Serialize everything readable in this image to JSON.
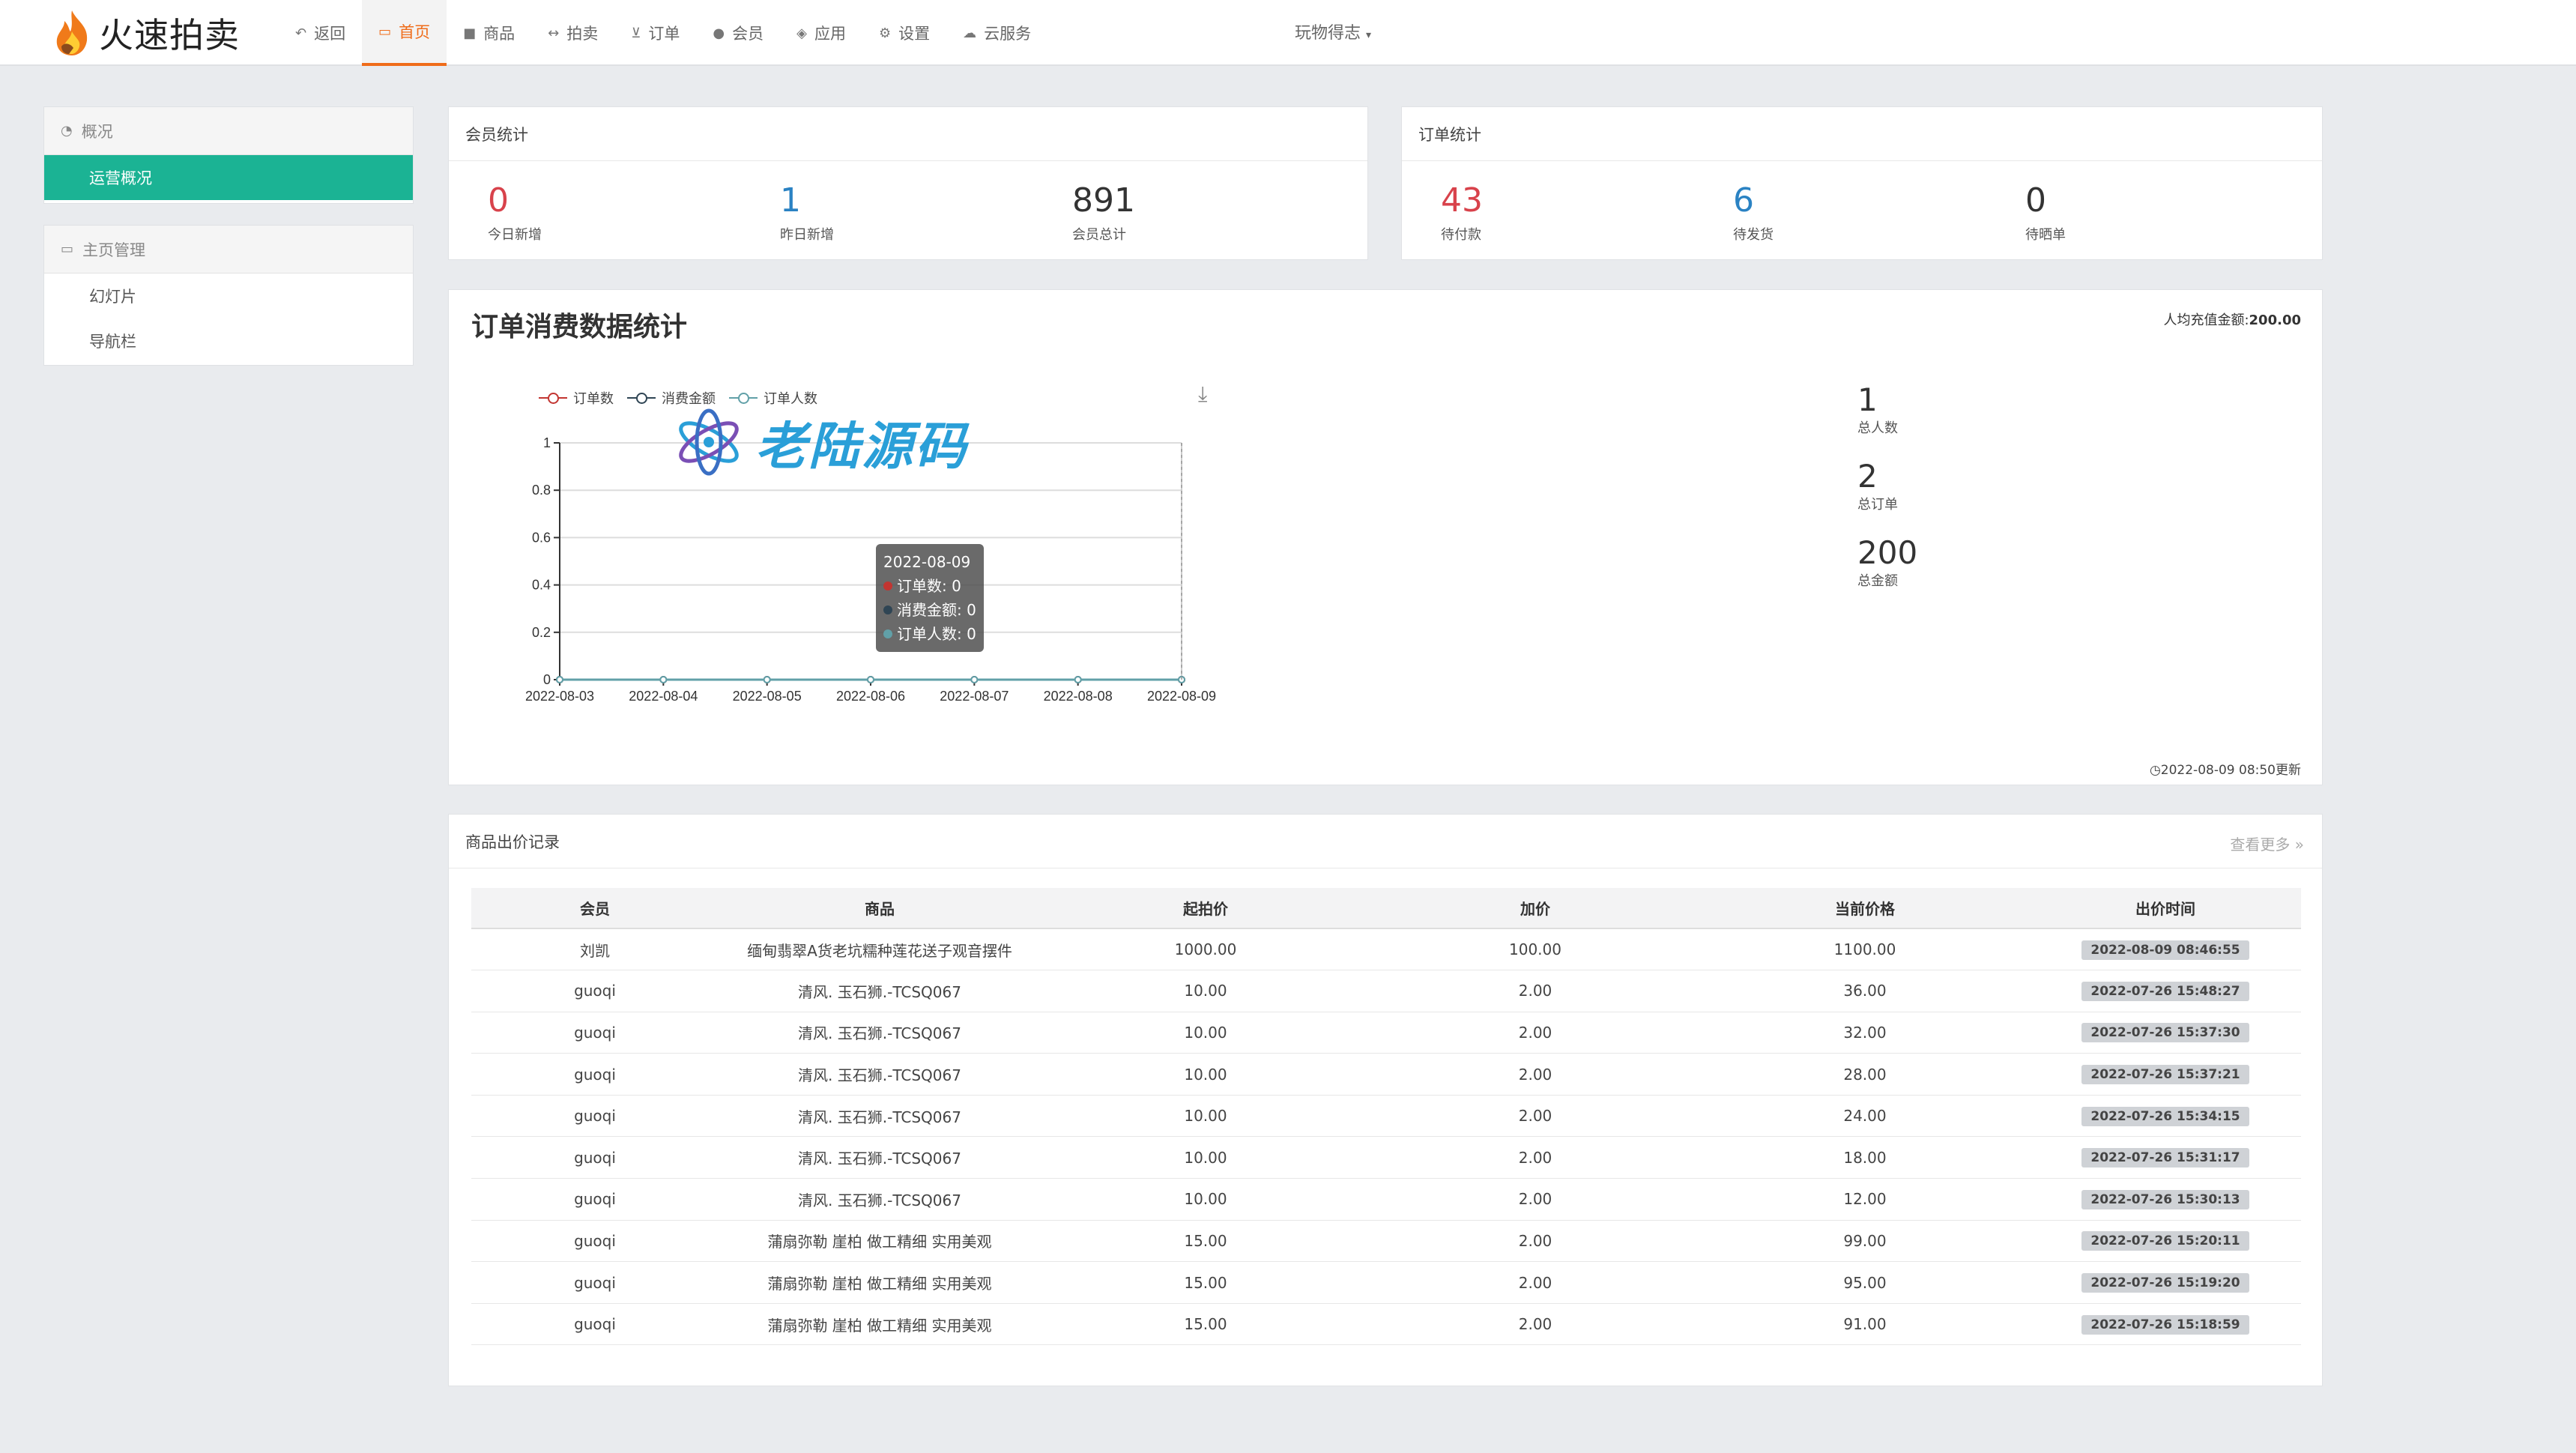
{
  "brand": {
    "name": "火速拍卖",
    "colors": {
      "accent": "#ef6c1a",
      "green": "#1bb394",
      "red": "#d8424b",
      "blue": "#2a82c3"
    }
  },
  "nav": {
    "items": [
      {
        "icon": "reply-icon",
        "label": "返回"
      },
      {
        "icon": "monitor-icon",
        "label": "首页",
        "active": true
      },
      {
        "icon": "gift-icon",
        "label": "商品"
      },
      {
        "icon": "arrows-h-icon",
        "label": "拍卖"
      },
      {
        "icon": "cart-icon",
        "label": "订单"
      },
      {
        "icon": "users-icon",
        "label": "会员"
      },
      {
        "icon": "cubes-icon",
        "label": "应用"
      },
      {
        "icon": "gear-icon",
        "label": "设置"
      },
      {
        "icon": "cloud-icon",
        "label": "云服务"
      }
    ],
    "user_menu": "玩物得志"
  },
  "sidebar": {
    "group1": {
      "title": "概况",
      "items": [
        {
          "label": "运营概况",
          "active": true
        }
      ]
    },
    "group2": {
      "title": "主页管理",
      "items": [
        {
          "label": "幻灯片"
        },
        {
          "label": "导航栏"
        }
      ]
    }
  },
  "member_stats": {
    "title": "会员统计",
    "items": [
      {
        "value": "0",
        "label": "今日新增"
      },
      {
        "value": "1",
        "label": "昨日新增"
      },
      {
        "value": "891",
        "label": "会员总计"
      }
    ]
  },
  "order_stats": {
    "title": "订单统计",
    "items": [
      {
        "value": "43",
        "label": "待付款"
      },
      {
        "value": "6",
        "label": "待发货"
      },
      {
        "value": "0",
        "label": "待晒单"
      }
    ]
  },
  "consumption": {
    "title": "订单消费数据统计",
    "avg_label": "人均充值金额:",
    "avg_value": "200.00",
    "kpis": [
      {
        "value": "1",
        "label": "总人数"
      },
      {
        "value": "2",
        "label": "总订单"
      },
      {
        "value": "200",
        "label": "总金额"
      }
    ],
    "updated": "2022-08-09 08:50更新",
    "tooltip": {
      "date": "2022-08-09",
      "rows": [
        "订单数: 0",
        "消费金额: 0",
        "订单人数: 0"
      ]
    }
  },
  "chart_data": {
    "type": "line",
    "x": [
      "2022-08-03",
      "2022-08-04",
      "2022-08-05",
      "2022-08-06",
      "2022-08-07",
      "2022-08-08",
      "2022-08-09"
    ],
    "series": [
      {
        "name": "订单数",
        "values": [
          0,
          0,
          0,
          0,
          0,
          0,
          0
        ],
        "color": "#c23531"
      },
      {
        "name": "消费金额",
        "values": [
          0,
          0,
          0,
          0,
          0,
          0,
          0
        ],
        "color": "#2f4554"
      },
      {
        "name": "订单人数",
        "values": [
          0,
          0,
          0,
          0,
          0,
          0,
          0
        ],
        "color": "#61a0a8"
      }
    ],
    "yticks": [
      "0",
      "0.2",
      "0.4",
      "0.6",
      "0.8",
      "1"
    ],
    "ylim": [
      0,
      1
    ],
    "grid": true,
    "legend": "top-left"
  },
  "watermark": {
    "text": "老陆源码"
  },
  "bids": {
    "title": "商品出价记录",
    "more": "查看更多 »",
    "headers": [
      "会员",
      "商品",
      "起拍价",
      "加价",
      "当前价格",
      "出价时间"
    ],
    "rows": [
      [
        "刘凯",
        "缅甸翡翠A货老坑糯种莲花送子观音摆件",
        "1000.00",
        "100.00",
        "1100.00",
        "2022-08-09 08:46:55"
      ],
      [
        "guoqi",
        "清风. 玉石狮.-TCSQ067",
        "10.00",
        "2.00",
        "36.00",
        "2022-07-26 15:48:27"
      ],
      [
        "guoqi",
        "清风. 玉石狮.-TCSQ067",
        "10.00",
        "2.00",
        "32.00",
        "2022-07-26 15:37:30"
      ],
      [
        "guoqi",
        "清风. 玉石狮.-TCSQ067",
        "10.00",
        "2.00",
        "28.00",
        "2022-07-26 15:37:21"
      ],
      [
        "guoqi",
        "清风. 玉石狮.-TCSQ067",
        "10.00",
        "2.00",
        "24.00",
        "2022-07-26 15:34:15"
      ],
      [
        "guoqi",
        "清风. 玉石狮.-TCSQ067",
        "10.00",
        "2.00",
        "18.00",
        "2022-07-26 15:31:17"
      ],
      [
        "guoqi",
        "清风. 玉石狮.-TCSQ067",
        "10.00",
        "2.00",
        "12.00",
        "2022-07-26 15:30:13"
      ],
      [
        "guoqi",
        "蒲扇弥勒 崖柏 做工精细 实用美观",
        "15.00",
        "2.00",
        "99.00",
        "2022-07-26 15:20:11"
      ],
      [
        "guoqi",
        "蒲扇弥勒 崖柏 做工精细 实用美观",
        "15.00",
        "2.00",
        "95.00",
        "2022-07-26 15:19:20"
      ],
      [
        "guoqi",
        "蒲扇弥勒 崖柏 做工精细 实用美观",
        "15.00",
        "2.00",
        "91.00",
        "2022-07-26 15:18:59"
      ]
    ]
  }
}
